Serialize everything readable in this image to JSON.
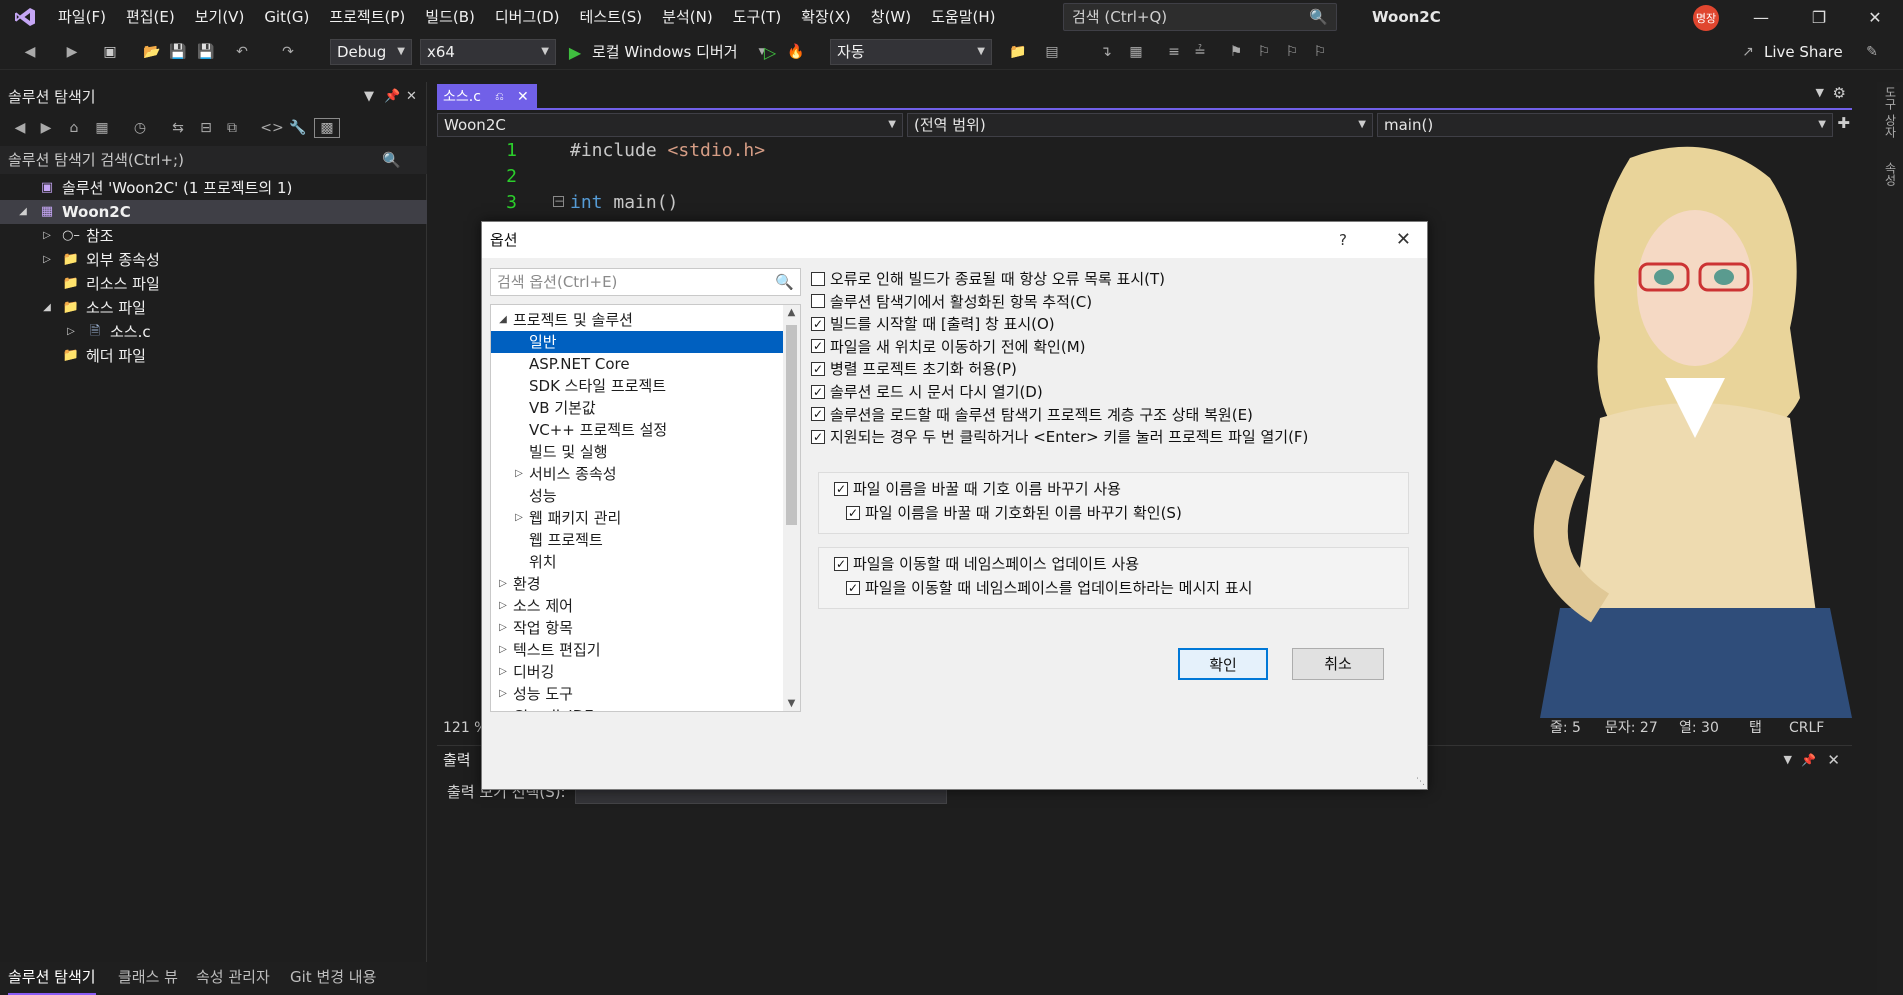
{
  "titlebar": {
    "menus": [
      "파일(F)",
      "편집(E)",
      "보기(V)",
      "Git(G)",
      "프로젝트(P)",
      "빌드(B)",
      "디버그(D)",
      "테스트(S)",
      "분석(N)",
      "도구(T)",
      "확장(X)",
      "창(W)",
      "도움말(H)"
    ],
    "search_placeholder": "검색 (Ctrl+Q)",
    "app_name": "Woon2C",
    "user_badge": "명장"
  },
  "toolbar": {
    "config": "Debug",
    "platform": "x64",
    "run_label": "로컬 Windows 디버거",
    "auto_label": "자동",
    "live_share": "Live Share"
  },
  "solution_explorer": {
    "title": "솔루션 탐색기",
    "search_placeholder": "솔루션 탐색기 검색(Ctrl+;)",
    "tree": [
      {
        "label": "솔루션 'Woon2C' (1 프로젝트의 1)",
        "level": 0,
        "expander": "",
        "icon": "solution-icon"
      },
      {
        "label": "Woon2C",
        "level": 0,
        "expander": "◢",
        "icon": "project-icon",
        "selected": true,
        "bold": true
      },
      {
        "label": "참조",
        "level": 1,
        "expander": "▷",
        "icon": "references-icon"
      },
      {
        "label": "외부 종속성",
        "level": 1,
        "expander": "▷",
        "icon": "folder-icon"
      },
      {
        "label": "리소스 파일",
        "level": 1,
        "expander": "",
        "icon": "filter-folder-icon"
      },
      {
        "label": "소스 파일",
        "level": 1,
        "expander": "◢",
        "icon": "filter-folder-icon"
      },
      {
        "label": "소스.c",
        "level": 2,
        "expander": "▷",
        "icon": "c-file-icon"
      },
      {
        "label": "헤더 파일",
        "level": 1,
        "expander": "",
        "icon": "filter-folder-icon"
      }
    ],
    "bottom_tabs": [
      "솔루션 탐색기",
      "클래스 뷰",
      "속성 관리자",
      "Git 변경 내용"
    ]
  },
  "editor": {
    "tab_label": "소스.c",
    "nav_project": "Woon2C",
    "nav_scope": "(전역 범위)",
    "nav_member": "main()",
    "lines": [
      {
        "num": "1",
        "segments": [
          {
            "t": "#include ",
            "c": "plain"
          },
          {
            "t": "<stdio.h>",
            "c": "inc"
          }
        ]
      },
      {
        "num": "2",
        "segments": []
      },
      {
        "num": "3",
        "segments": [
          {
            "t": "int",
            "c": "kw"
          },
          {
            "t": " main()",
            "c": "plain"
          }
        ]
      }
    ],
    "zoom": "121 %",
    "status": {
      "line": "줄: 5",
      "char": "문자: 27",
      "col": "열: 30",
      "tab": "탭",
      "eol": "CRLF"
    }
  },
  "output": {
    "title": "출력",
    "source_label": "출력 보기 선택(S):"
  },
  "right_rail": [
    "도구 상자",
    "속성"
  ],
  "options_dialog": {
    "title": "옵션",
    "help": "?",
    "search_placeholder": "검색 옵션(Ctrl+E)",
    "tree": [
      {
        "label": "프로젝트 및 솔루션",
        "level": 0,
        "expander": "◢"
      },
      {
        "label": "일반",
        "level": 1,
        "expander": "",
        "selected": true
      },
      {
        "label": "ASP.NET Core",
        "level": 1,
        "expander": ""
      },
      {
        "label": "SDK 스타일 프로젝트",
        "level": 1,
        "expander": ""
      },
      {
        "label": "VB 기본값",
        "level": 1,
        "expander": ""
      },
      {
        "label": "VC++ 프로젝트 설정",
        "level": 1,
        "expander": ""
      },
      {
        "label": "빌드 및 실행",
        "level": 1,
        "expander": ""
      },
      {
        "label": "서비스 종속성",
        "level": 1,
        "expander": "▷"
      },
      {
        "label": "성능",
        "level": 1,
        "expander": ""
      },
      {
        "label": "웹 패키지 관리",
        "level": 1,
        "expander": "▷"
      },
      {
        "label": "웹 프로젝트",
        "level": 1,
        "expander": ""
      },
      {
        "label": "위치",
        "level": 1,
        "expander": ""
      },
      {
        "label": "환경",
        "level": 0,
        "expander": "▷"
      },
      {
        "label": "소스 제어",
        "level": 0,
        "expander": "▷"
      },
      {
        "label": "작업 항목",
        "level": 0,
        "expander": "▷"
      },
      {
        "label": "텍스트 편집기",
        "level": 0,
        "expander": "▷"
      },
      {
        "label": "디버깅",
        "level": 0,
        "expander": "▷"
      },
      {
        "label": "성능 도구",
        "level": 0,
        "expander": "▷"
      },
      {
        "label": "ClaudicIDE",
        "level": 0,
        "expander": "▷"
      }
    ],
    "options": [
      {
        "label": "오류로 인해 빌드가 종료될 때 항상 오류 목록 표시(T)",
        "checked": false
      },
      {
        "label": "솔루션 탐색기에서 활성화된 항목 추적(C)",
        "checked": false
      },
      {
        "label": "빌드를 시작할 때 [출력] 창 표시(O)",
        "checked": true
      },
      {
        "label": "파일을 새 위치로 이동하기 전에 확인(M)",
        "checked": true
      },
      {
        "label": "병렬 프로젝트 초기화 허용(P)",
        "checked": true
      },
      {
        "label": "솔루션 로드 시 문서 다시 열기(D)",
        "checked": true
      },
      {
        "label": "솔루션을 로드할 때 솔루션 탐색기 프로젝트 계층 구조 상태 복원(E)",
        "checked": true
      },
      {
        "label": "지원되는 경우 두 번 클릭하거나 <Enter> 키를 눌러 프로젝트 파일 열기(F)",
        "checked": true
      }
    ],
    "group1": [
      {
        "label": "파일 이름을 바꿀 때 기호 이름 바꾸기 사용",
        "checked": true
      },
      {
        "label": "파일 이름을 바꿀 때 기호화된 이름 바꾸기 확인(S)",
        "checked": true
      }
    ],
    "group2": [
      {
        "label": "파일을 이동할 때 네임스페이스 업데이트 사용",
        "checked": true
      },
      {
        "label": "파일을 이동할 때 네임스페이스를 업데이트하라는 메시지 표시",
        "checked": true
      }
    ],
    "ok_label": "확인",
    "cancel_label": "취소"
  },
  "colors": {
    "accent": "#7160e8",
    "selection": "#0060c0",
    "line_number": "#2bcf2b"
  }
}
